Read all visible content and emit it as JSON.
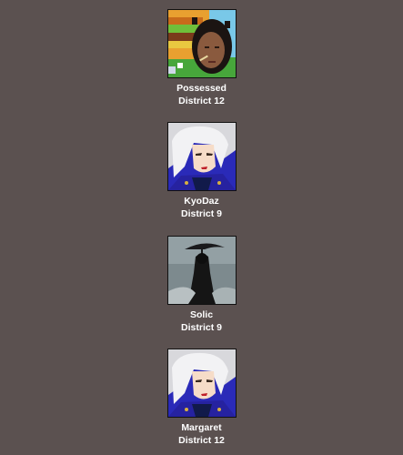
{
  "tributes": [
    {
      "name": "Possessed",
      "district": "District 12",
      "avatar_icon": "hamburger-pixel-portrait-icon"
    },
    {
      "name": "KyoDaz",
      "district": "District 9",
      "avatar_icon": "white-haired-anime-woman-icon"
    },
    {
      "name": "Solic",
      "district": "District 9",
      "avatar_icon": "reaper-with-scythe-icon"
    },
    {
      "name": "Margaret",
      "district": "District 12",
      "avatar_icon": "white-haired-anime-woman-icon"
    }
  ],
  "colors": {
    "background": "#5b5150",
    "text": "#ffffff",
    "avatar_border": "#111111"
  }
}
